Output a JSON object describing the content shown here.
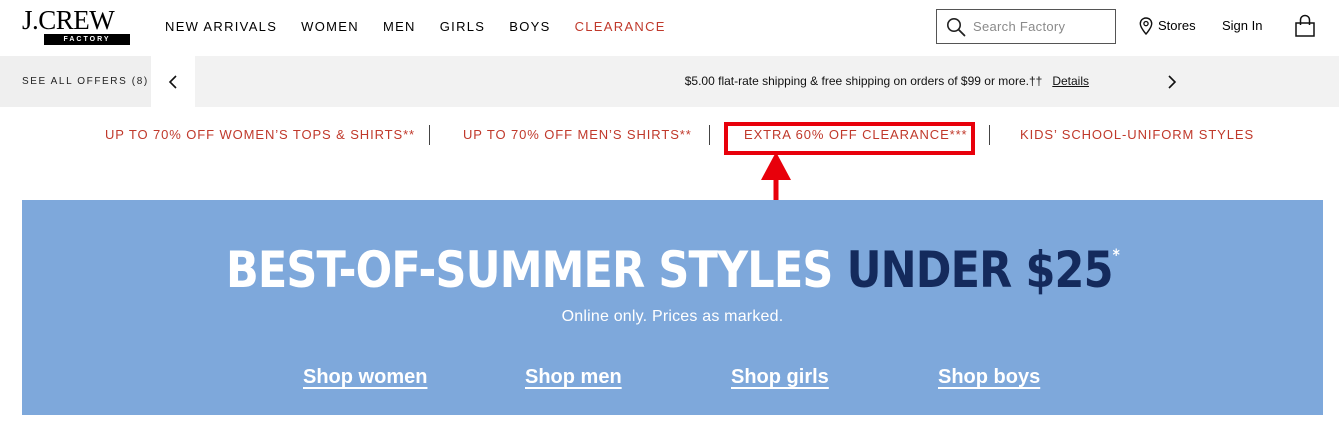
{
  "header": {
    "logo_word": "J.CREW",
    "logo_tag": "FACTORY",
    "nav": [
      "NEW ARRIVALS",
      "WOMEN",
      "MEN",
      "GIRLS",
      "BOYS",
      "CLEARANCE"
    ],
    "search": {
      "placeholder": "Search Factory",
      "value": ""
    },
    "stores_label": "Stores",
    "signin_label": "Sign In",
    "icons": [
      "search-icon",
      "location-pin-icon",
      "shopping-bag-icon"
    ]
  },
  "offers_bar": {
    "see_all_label": "SEE ALL OFFERS (8)",
    "promo_text": "$5.00 flat-rate shipping & free shipping on orders of $99 or more.††",
    "details_label": "Details",
    "icons": [
      "chevron-left-icon",
      "chevron-right-icon"
    ]
  },
  "categories": [
    "UP TO 70% OFF WOMEN’S TOPS & SHIRTS**",
    "UP TO 70% OFF MEN’S SHIRTS**",
    "EXTRA 60% OFF CLEARANCE***",
    "KIDS’ SCHOOL-UNIFORM STYLES"
  ],
  "banner": {
    "headline_white": "BEST-OF-SUMMER STYLES",
    "headline_navy": "UNDER $25",
    "headline_star": "*",
    "subline": "Online only. Prices as marked.",
    "shop_links": [
      "Shop women",
      "Shop men",
      "Shop girls",
      "Shop boys"
    ]
  },
  "colors": {
    "accent_red": "#c0392b",
    "annotation_red": "#e8000b",
    "banner_blue": "#7ea8db",
    "headline_navy": "#142a5c",
    "offers_bg": "#efefef"
  }
}
